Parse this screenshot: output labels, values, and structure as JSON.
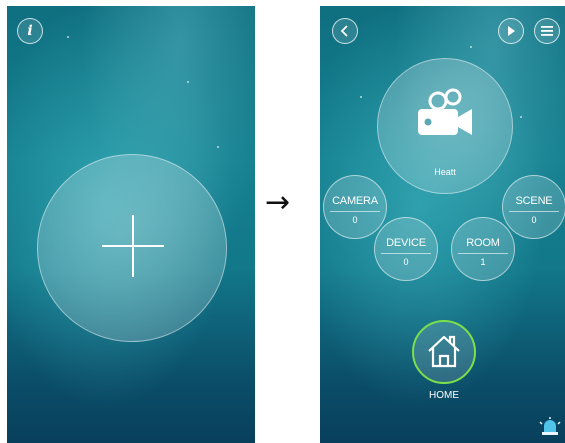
{
  "transition_arrow": "→",
  "left_screen": {
    "info_button_label": "i",
    "add_button_icon": "plus-icon"
  },
  "right_screen": {
    "back_icon": "chevron-left-icon",
    "play_icon": "play-icon",
    "menu_icon": "menu-icon",
    "camera_hub": {
      "icon": "video-camera-icon",
      "label": "Heatt"
    },
    "categories": [
      {
        "label": "CAMERA",
        "count": "0"
      },
      {
        "label": "SCENE",
        "count": "0"
      },
      {
        "label": "DEVICE",
        "count": "0"
      },
      {
        "label": "ROOM",
        "count": "1"
      }
    ],
    "home": {
      "icon": "house-icon",
      "label": "HOME",
      "ring_color": "#7be04a"
    },
    "alarm_icon": "alarm-light-icon"
  }
}
